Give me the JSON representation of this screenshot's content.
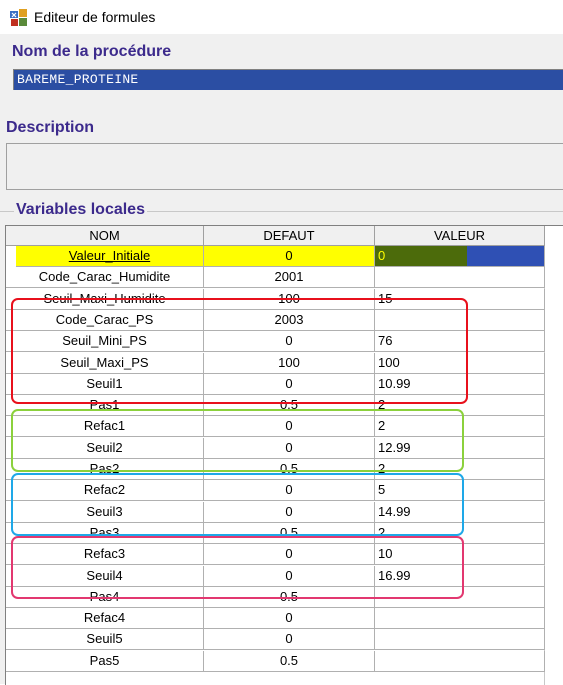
{
  "window": {
    "title": "Editeur de formules",
    "icon": "formula-editor-app-icon"
  },
  "procedure": {
    "label": "Nom de la procédure",
    "value": "BAREME_PROTEINE"
  },
  "description": {
    "label": "Description",
    "value": ""
  },
  "variables": {
    "label": "Variables locales",
    "columns": [
      "NOM",
      "DEFAUT",
      "VALEUR"
    ],
    "rows": [
      {
        "nom": "Valeur_Initiale",
        "defaut": "0",
        "valeur": "0"
      },
      {
        "nom": "Code_Carac_Humidite",
        "defaut": "2001",
        "valeur": ""
      },
      {
        "nom": "Seuil_Maxi_Humidite",
        "defaut": "100",
        "valeur": "15"
      },
      {
        "nom": "Code_Carac_PS",
        "defaut": "2003",
        "valeur": ""
      },
      {
        "nom": "Seuil_Mini_PS",
        "defaut": "0",
        "valeur": "76"
      },
      {
        "nom": "Seuil_Maxi_PS",
        "defaut": "100",
        "valeur": "100"
      },
      {
        "nom": "Seuil1",
        "defaut": "0",
        "valeur": "10.99"
      },
      {
        "nom": "Pas1",
        "defaut": "0.5",
        "valeur": "2"
      },
      {
        "nom": "Refac1",
        "defaut": "0",
        "valeur": "2"
      },
      {
        "nom": "Seuil2",
        "defaut": "0",
        "valeur": "12.99"
      },
      {
        "nom": "Pas2",
        "defaut": "0.5",
        "valeur": "2"
      },
      {
        "nom": "Refac2",
        "defaut": "0",
        "valeur": "5"
      },
      {
        "nom": "Seuil3",
        "defaut": "0",
        "valeur": "14.99"
      },
      {
        "nom": "Pas3",
        "defaut": "0.5",
        "valeur": "2"
      },
      {
        "nom": "Refac3",
        "defaut": "0",
        "valeur": "10"
      },
      {
        "nom": "Seuil4",
        "defaut": "0",
        "valeur": "16.99"
      },
      {
        "nom": "Pas4",
        "defaut": "0.5",
        "valeur": ""
      },
      {
        "nom": "Refac4",
        "defaut": "0",
        "valeur": ""
      },
      {
        "nom": "Seuil5",
        "defaut": "0",
        "valeur": ""
      },
      {
        "nom": "Pas5",
        "defaut": "0.5",
        "valeur": ""
      }
    ]
  },
  "highlight_colors": {
    "red": "#e8101c",
    "green": "#8bd13c",
    "blue": "#1ea8e8",
    "pink": "#e23870"
  }
}
